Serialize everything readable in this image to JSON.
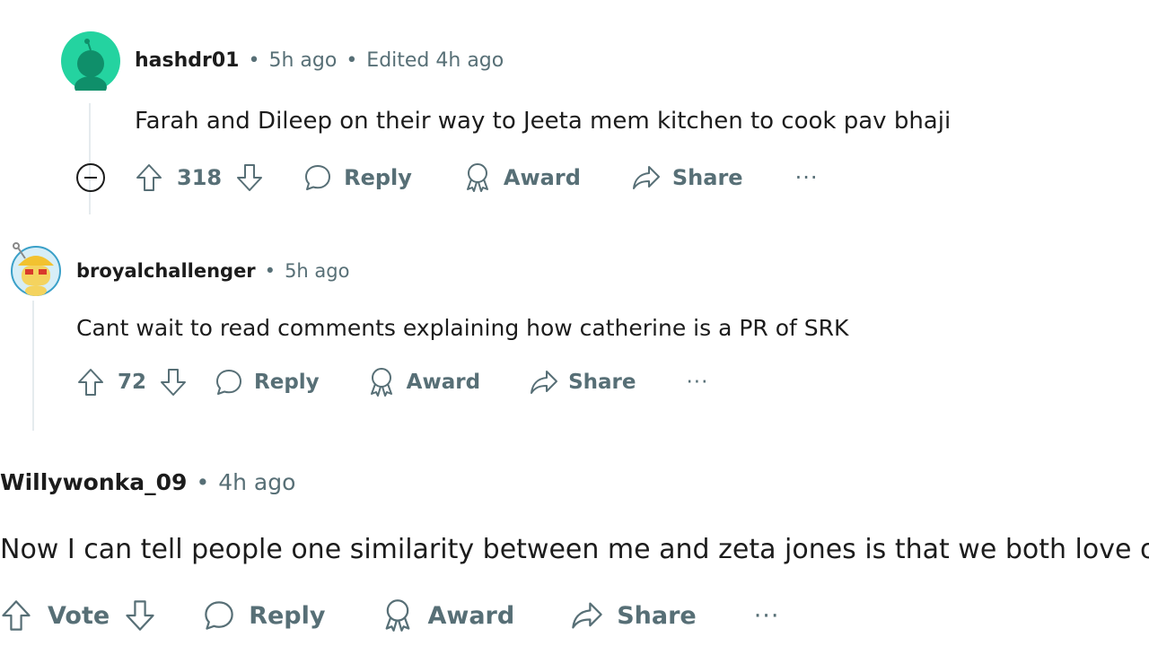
{
  "comments": [
    {
      "author": "hashdr01",
      "time": "5h ago",
      "edited": "Edited 4h ago",
      "body": "Farah and Dileep on their way to Jeeta mem kitchen to cook pav bhaji",
      "score": "318",
      "reply_label": "Reply",
      "award_label": "Award",
      "share_label": "Share",
      "avatar_color": "#24d3a0"
    },
    {
      "author": "broyalchallenger",
      "time": "5h ago",
      "body": "Cant wait to read comments explaining how catherine is a PR of SRK",
      "score": "72",
      "reply_label": "Reply",
      "award_label": "Award",
      "share_label": "Share"
    },
    {
      "author": "Willywonka_09",
      "time": "4h ago",
      "body": "Now I can tell people one similarity between me and zeta jones is that we both love oscar",
      "score": "Vote",
      "reply_label": "Reply",
      "award_label": "Award",
      "share_label": "Share"
    }
  ],
  "separator": "•",
  "more_label": "···",
  "icons": {
    "upvote": "arrow-up-icon",
    "downvote": "arrow-down-icon",
    "reply": "speech-bubble-icon",
    "award": "award-ribbon-icon",
    "share": "share-arrow-icon",
    "collapse": "minus-circle-icon"
  }
}
